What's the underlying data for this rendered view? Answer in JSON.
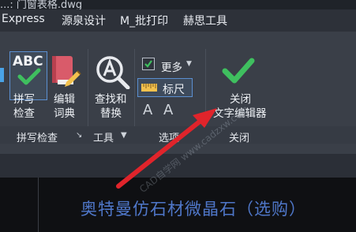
{
  "window": {
    "title": "...: 门窗表格.dwg"
  },
  "menu": {
    "items": [
      "Express",
      "源泉设计",
      "M_批打印",
      "赫思工具"
    ]
  },
  "ribbon": {
    "spellcheck_button": "拼写\n检查",
    "spellcheck_line1": "拼写",
    "spellcheck_line2": "检查",
    "dictionary_line1": "编辑",
    "dictionary_line2": "词典",
    "findreplace_line1": "查找和",
    "findreplace_line2": "替换",
    "more_label": "更多",
    "ruler_label": "标尺",
    "close_line1": "关闭",
    "close_line2": "文字编辑器",
    "abc_text": "ABC"
  },
  "groups": {
    "spellcheck": "拼写检查",
    "tools": "工具",
    "options": "选项",
    "close": "关闭"
  },
  "document": {
    "text": "奥特曼仿石材微晶石（选购）"
  },
  "watermark": "CAD自学网 www.cadzxw.com",
  "colors": {
    "accent": "#3fbf5f",
    "arrow": "#e0242b",
    "doc_text": "#4f77c9"
  }
}
